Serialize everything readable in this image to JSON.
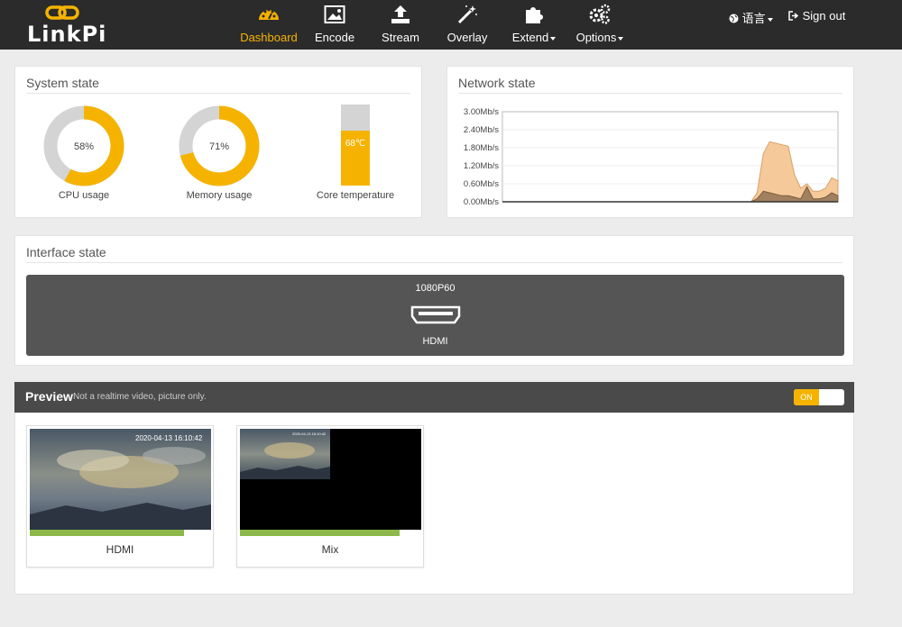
{
  "app": {
    "logo_text": "LinkPi"
  },
  "nav": {
    "items": [
      {
        "label": "Dashboard",
        "icon": "dashboard-icon",
        "active": true
      },
      {
        "label": "Encode",
        "icon": "image-icon"
      },
      {
        "label": "Stream",
        "icon": "upload-icon"
      },
      {
        "label": "Overlay",
        "icon": "magic-wand-icon"
      },
      {
        "label": "Extend",
        "icon": "puzzle-icon",
        "dropdown": true
      },
      {
        "label": "Options",
        "icon": "gears-icon",
        "dropdown": true
      }
    ],
    "language_label": "语言",
    "signout_label": "Sign out"
  },
  "system_state": {
    "title": "System state",
    "cpu": {
      "value": 58,
      "value_text": "58%",
      "label": "CPU usage"
    },
    "memory": {
      "value": 71,
      "value_text": "71%",
      "label": "Memory usage"
    },
    "temperature": {
      "value_text": "68℃",
      "label": "Core temperature",
      "level": 0.68
    }
  },
  "chart_data": {
    "type": "area",
    "title": "Network state",
    "ylim": [
      0,
      3.0
    ],
    "yticks": [
      "3.00Mb/s",
      "2.40Mb/s",
      "1.80Mb/s",
      "1.20Mb/s",
      "0.60Mb/s",
      "0.00Mb/s"
    ],
    "grid": true,
    "series": [
      {
        "values": [
          0,
          0,
          0,
          0,
          0,
          0,
          0,
          0,
          0,
          0,
          0,
          0,
          0,
          0,
          0,
          0,
          0,
          0,
          0,
          0,
          0,
          0,
          0,
          0,
          0,
          0,
          0,
          0,
          0,
          0,
          0,
          0,
          0,
          0,
          0,
          0,
          0,
          0,
          0,
          0,
          0,
          0.3,
          1.6,
          2.0,
          1.95,
          1.9,
          1.85,
          0.9,
          0.45,
          0.6,
          0.35,
          0.35,
          0.45,
          0.8,
          0.7
        ],
        "color": "#f5c99a"
      },
      {
        "values": [
          0,
          0,
          0,
          0,
          0,
          0,
          0,
          0,
          0,
          0,
          0,
          0,
          0,
          0,
          0,
          0,
          0,
          0,
          0,
          0,
          0,
          0,
          0,
          0,
          0,
          0,
          0,
          0,
          0,
          0,
          0,
          0,
          0,
          0,
          0,
          0,
          0,
          0,
          0,
          0,
          0,
          0.1,
          0.35,
          0.3,
          0.25,
          0.2,
          0.2,
          0.15,
          0.1,
          0.5,
          0.1,
          0.1,
          0.15,
          0.3,
          0.2
        ],
        "color": "#a08060"
      }
    ]
  },
  "interface_state": {
    "title": "Interface state",
    "resolution": "1080P60",
    "port_label": "HDMI"
  },
  "preview": {
    "title": "Preview",
    "subtitle": "Not a realtime video, picture only.",
    "toggle_label": "ON",
    "thumbs": [
      {
        "label": "HDMI",
        "timestamp": "2020-04-13 16:10:42",
        "progress": 0.85
      },
      {
        "label": "Mix",
        "timestamp": "2020-04-13 16:10:42",
        "progress": 0.88
      }
    ]
  },
  "colors": {
    "accent": "#f5b300",
    "gauge_track": "#d4d4d4",
    "navbar": "#2b2b2b",
    "progress": "#8cb84a"
  }
}
